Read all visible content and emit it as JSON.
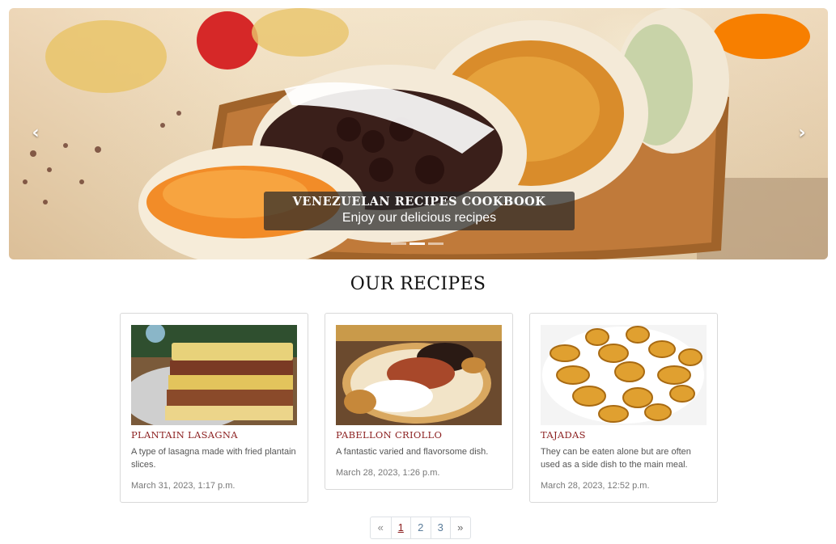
{
  "carousel": {
    "caption_title": "VENEZUELAN RECIPES COOKBOOK",
    "caption_text": "Enjoy our delicious recipes",
    "prev_icon": "chevron-left-icon",
    "next_icon": "chevron-right-icon",
    "slides_count": 3,
    "active_slide": 2
  },
  "section": {
    "title": "OUR RECIPES"
  },
  "recipes": [
    {
      "title": "PLANTAIN LASAGNA",
      "description": "A type of lasagna made with fried plantain slices.",
      "date": "March 31, 2023, 1:17 p.m."
    },
    {
      "title": "PABELLON CRIOLLO",
      "description": "A fantastic varied and flavorsome dish.",
      "date": "March 28, 2023, 1:26 p.m."
    },
    {
      "title": "TAJADAS",
      "description": "They can be eaten alone but are often used as a side dish to the main meal.",
      "date": "March 28, 2023, 12:52 p.m."
    }
  ],
  "pagination": {
    "prev": "«",
    "pages": [
      "1",
      "2",
      "3"
    ],
    "next": "»",
    "current": "1"
  },
  "colors": {
    "accent": "#8b1e1e",
    "link": "#5a7c9a"
  }
}
